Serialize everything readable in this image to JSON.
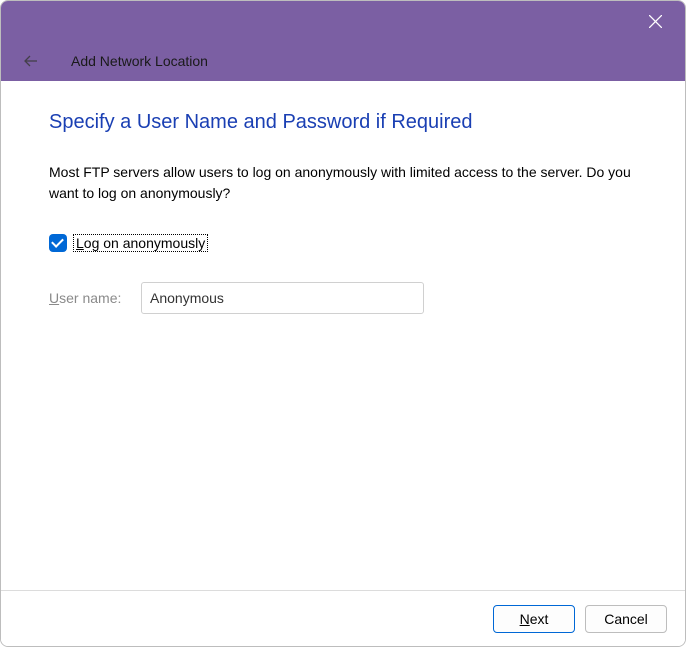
{
  "titlebar": {
    "header_title": "Add Network Location"
  },
  "page": {
    "heading": "Specify a User Name and Password if Required",
    "description": "Most FTP servers allow users to log on anonymously with limited access to the server.  Do you want to log on anonymously?",
    "checkbox_label_prefix": "L",
    "checkbox_label_rest": "og on anonymously",
    "checkbox_checked": true,
    "username_label_prefix": "U",
    "username_label_rest": "ser name:",
    "username_value": "Anonymous"
  },
  "footer": {
    "next_prefix": "N",
    "next_rest": "ext",
    "cancel_label": "Cancel"
  }
}
